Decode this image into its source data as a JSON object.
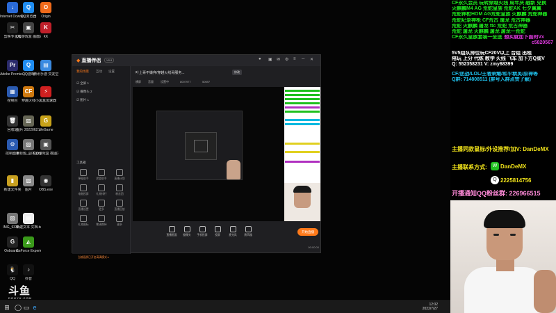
{
  "desktop": {
    "icons": [
      {
        "label": "Internet Downlo...",
        "glyph": "↓",
        "color": "#2a6ad8"
      },
      {
        "label": "QQ浏览器",
        "glyph": "Q",
        "color": "#1f8cf0"
      },
      {
        "label": "Origin",
        "glyph": "O",
        "color": "#f06a1a"
      },
      {
        "label": "剪映专业版",
        "glyph": "✂",
        "color": "#222"
      },
      {
        "label": "QQ游戏盒 画面2022...",
        "glyph": "▣",
        "color": "#444"
      },
      {
        "label": "KK",
        "glyph": "K",
        "color": "#c0202a"
      },
      {
        "label": "Adobe Premie...",
        "glyph": "Pr",
        "color": "#2a2a6a"
      },
      {
        "label": "QQ游戏",
        "glyph": "Q",
        "color": "#1f8cf0"
      },
      {
        "label": "腾讯手游 交友空间",
        "glyph": "▤",
        "color": "#3a8ae0"
      },
      {
        "label": "控制台",
        "glyph": "▦",
        "color": "#2a5ab0"
      },
      {
        "label": "穿越火线",
        "glyph": "CF",
        "color": "#d07a10"
      },
      {
        "label": "小黑盒加速器",
        "glyph": "⚡",
        "color": "#d02020"
      },
      {
        "label": "回收站",
        "glyph": "🗑",
        "color": "#333"
      },
      {
        "label": "图片 2022062...",
        "glyph": "▨",
        "color": "#665"
      },
      {
        "label": "WeGame",
        "glyph": "G",
        "color": "#c8a21a"
      },
      {
        "label": "控制面板",
        "glyph": "⚙",
        "color": "#2a5ab0"
      },
      {
        "label": "未标题_副本.png",
        "glyph": "▧",
        "color": "#777"
      },
      {
        "label": "QQ游戏盒 截图2022...",
        "glyph": "▣",
        "color": "#555"
      },
      {
        "label": "新建文件夹",
        "glyph": "▮",
        "color": "#c8a020"
      },
      {
        "label": "图片",
        "glyph": "▨",
        "color": "#888"
      },
      {
        "label": "OBS.exe",
        "glyph": "◉",
        "color": "#333"
      },
      {
        "label": "IMG_9338...",
        "glyph": "▨",
        "color": "#777"
      },
      {
        "label": "新建文本 文档.txt",
        "glyph": "▤",
        "color": "#eee"
      },
      {
        "label": "Onboard...",
        "glyph": "G",
        "color": "#222"
      },
      {
        "label": "GeForce Experience",
        "glyph": "◭",
        "color": "#3a9a1a"
      },
      {
        "label": "QQ",
        "glyph": "🐧",
        "color": "#111"
      },
      {
        "label": "抖音",
        "glyph": "♪",
        "color": "#111"
      }
    ]
  },
  "taskbar": {
    "start_glyph": "⊞",
    "icons": [
      "◯",
      "▭",
      "e"
    ],
    "time": "12:02",
    "date": "2022/7/27"
  },
  "app": {
    "title": "直播伴侣",
    "version": "V8.8",
    "sidebar_tabs": [
      "我的场景",
      "互动",
      "设置"
    ],
    "scenes": [
      "☑ 全屏 1",
      "☑ 摄像头 2",
      "☑ 图片 1"
    ],
    "tools_title": "工具箱",
    "tools": [
      "弹幕助手",
      "房管助手",
      "直播计划",
      "电脑投屏",
      "礼物排行",
      "粉丝团",
      "直播设置",
      "更多",
      "直播回放",
      "礼物图标",
      "敬请期待",
      "更多"
    ],
    "warning": "当前画质已开启高清模式 ▸",
    "stream_title": "叶上哥不嫌弃/穿越火线哥服务...",
    "stream_badge": "修改",
    "chips": [
      "横屏",
      "音量",
      "设置中",
      "8007977",
      "50697"
    ],
    "controls": [
      "直播画面",
      "摄像头",
      "手机投屏",
      "投屏",
      "麦克风",
      "扬声器"
    ],
    "go_live_label": "开始直播",
    "timer": "00:00:00"
  },
  "watermark": {
    "main": "斗鱼",
    "sub": "DOUYU.COM"
  },
  "right_panel": {
    "lines": [
      {
        "text": "CF永久会员 玩转穿越火线 周年庆 融新 兑换",
        "color": "green"
      },
      {
        "text": "火麒麟M4 AG 荒蛇皇族 荒蛇AK 七夕翼翼",
        "color": "green"
      },
      {
        "text": "荒蛇神枪HOM AG荒蛇皇族 火麒麟 荒蛇神器",
        "color": "green"
      },
      {
        "text": "荒蛇纪录神枪 CF荒古 屠龙 荒古神器",
        "color": "green"
      },
      {
        "text": "荒蛇 火麒麟 屠龙 ttc 荒蛇 荒古神器",
        "color": "green"
      },
      {
        "text": "荒蛇 屠龙 火麒麟 屠龙 屠龙一荒蛇",
        "color": "green"
      },
      {
        "text": "CF永久皇族套装一全送",
        "color": "green",
        "extra": "想买就加下面的Vx"
      },
      {
        "text": "c5820567",
        "color": "magenta"
      },
      {
        "text": "5V5组队排位玩CF20V以上   合组 出租",
        "color": "white"
      },
      {
        "text": "陪玩 上分 代练 教学 火线 飞车 加下方Q或V",
        "color": "white"
      },
      {
        "text": "Q: 552358231 V: zmy68399",
        "color": "white"
      },
      {
        "text": "CF/逆战/LOL/王者荣耀/和平精英/原神等",
        "color": "cyan"
      },
      {
        "text": "Q群: 714808511 (群号入群点赞了解)",
        "color": "cyan"
      }
    ]
  },
  "contact": {
    "line1": "主播同款鼠标/外设推荐/加V: DanDeMX",
    "line2": "主播联系方式:",
    "wechat_glyph": "W",
    "wechat": "DanDeMX",
    "qq_glyph": "Q",
    "qq": "2225814756",
    "fan_group": "开播通知QQ粉丝群: 226966515"
  }
}
